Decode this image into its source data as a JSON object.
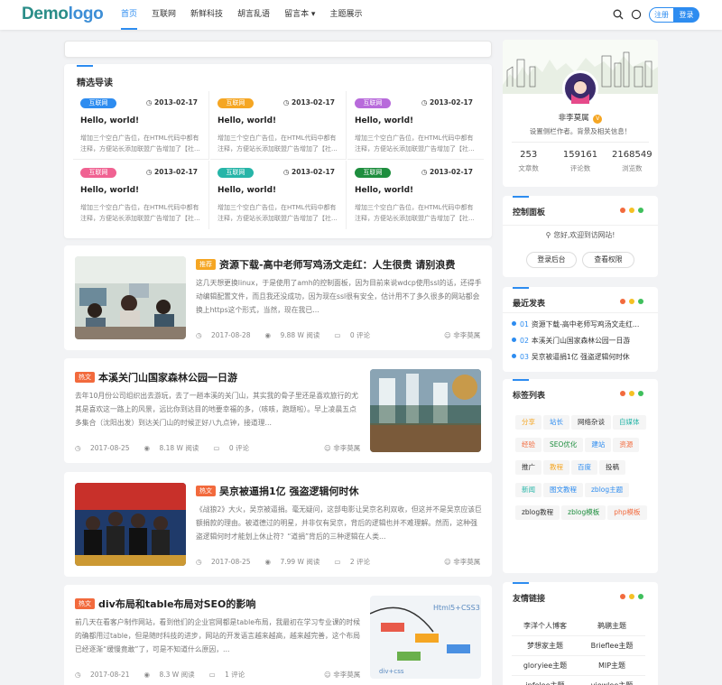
{
  "header": {
    "logo_a": "Demo",
    "logo_b": "logo",
    "nav": [
      "首页",
      "互联网",
      "新鲜科技",
      "胡言乱语",
      "留言本 ▾",
      "主题展示"
    ],
    "register_label": "注册",
    "login_label": "登录",
    "icons": [
      "search-icon",
      "theme-toggle-icon"
    ]
  },
  "featured": {
    "title": "精选导读",
    "items": [
      {
        "tag": "互联网",
        "color": "#2d8cf0",
        "date": "2013-02-17",
        "title": "Hello, world!",
        "desc": "增加三个空白广告位，在HTML代码中都有注释，方便站长添加联盟广告增加了【社..."
      },
      {
        "tag": "互联网",
        "color": "#f5a623",
        "date": "2013-02-17",
        "title": "Hello, world!",
        "desc": "增加三个空白广告位，在HTML代码中都有注释，方便站长添加联盟广告增加了【社..."
      },
      {
        "tag": "互联网",
        "color": "#b86bdb",
        "date": "2013-02-17",
        "title": "Hello, world!",
        "desc": "增加三个空白广告位，在HTML代码中都有注释，方便站长添加联盟广告增加了【社..."
      },
      {
        "tag": "互联网",
        "color": "#f06292",
        "date": "2013-02-17",
        "title": "Hello, world!",
        "desc": "增加三个空白广告位，在HTML代码中都有注释，方便站长添加联盟广告增加了【社..."
      },
      {
        "tag": "互联网",
        "color": "#26b5a8",
        "date": "2013-02-17",
        "title": "Hello, world!",
        "desc": "增加三个空白广告位，在HTML代码中都有注释，方便站长添加联盟广告增加了【社..."
      },
      {
        "tag": "互联网",
        "color": "#1e8e3e",
        "date": "2013-02-17",
        "title": "Hello, world!",
        "desc": "增加三个空白广告位，在HTML代码中都有注释，方便站长添加联盟广告增加了【社..."
      }
    ]
  },
  "posts": [
    {
      "tag": "推荐",
      "tag_color": "#f5a623",
      "title": "资源下载-高中老师写鸡汤文走红：人生很贵 请别浪费",
      "desc": "这几天想更换linux，于是使用了amh的控制面板，因为目前来说wdcp使用ssl的话，还得手动编辑配置文件，而且我还没成功，因为现在ssl很有安全，估计用不了多久很多的网站都会换上https这个形式，当然，现在我已...",
      "date": "2017-08-28",
      "views": "9.88 W 阅读",
      "comments": "0 评论",
      "author": "非李莫属"
    },
    {
      "tag": "热文",
      "tag_color": "#f26a3d",
      "title": "本溪关门山国家森林公园一日游",
      "desc": "去年10月份公司组织出去游玩，去了一趟本溪的关门山，其实我的骨子里还是喜欢旅行的尤其是喜欢这一路上的风景，远比你到达目的地要幸福的多，（咳咳，跑题啦）。早上凌晨五点多集合（沈阳出发）到达关门山的时候正好八九点钟，接道理...",
      "date": "2017-08-25",
      "views": "8.18 W 阅读",
      "comments": "0 评论",
      "author": "非李莫属"
    },
    {
      "tag": "热文",
      "tag_color": "#f26a3d",
      "title": "吴京被逼捐1亿 强盗逻辑何时休",
      "desc": "《战狼2》大火，吴京被逼捐。毫无疑问，这部电影让吴京名利双收，但这并不是吴京应该巨额捐款的理由。被道德过的明星，并非仅有吴京，背后的逻辑也并不难理解。然而，这种强盗逻辑何时才能划上休止符？“道捐”背后的三种逻辑在人类...",
      "date": "2017-08-25",
      "views": "7.99 W 阅读",
      "comments": "2 评论",
      "author": "非李莫属"
    },
    {
      "tag": "热文",
      "tag_color": "#f26a3d",
      "title": "div布局和table布局对SEO的影响",
      "desc": "前几天在看客户制作网站，看到他们的企业官网都是table布局，我最初在学习专业课的时候的确都用过table，但是随时科技的进步，网站的开发语言越来越高，越来越完善，这个布局已经逐渐“缓慢竟敢”了，可是不知道什么原因，...",
      "date": "2017-08-21",
      "views": "8.3 W 阅读",
      "comments": "1 评论",
      "author": "非李莫属"
    }
  ],
  "profile": {
    "name": "非李莫属",
    "badge": "V",
    "bio": "设置侧栏作者。背景及相关信息！",
    "stats": [
      {
        "value": "253",
        "label": "文章数"
      },
      {
        "value": "159161",
        "label": "评论数"
      },
      {
        "value": "2168549",
        "label": "浏览数"
      }
    ]
  },
  "control": {
    "title": "控制面板",
    "welcome": "您好,欢迎到访网站!",
    "btn_admin": "登录后台",
    "btn_perm": "查看权限"
  },
  "recent": {
    "title": "最近发表",
    "items": [
      {
        "num": "01",
        "text": "资源下载-高中老师写鸡汤文走红..."
      },
      {
        "num": "02",
        "text": "本溪关门山国家森林公园一日游"
      },
      {
        "num": "03",
        "text": "吴京被逼捐1亿 强盗逻辑何时休"
      }
    ]
  },
  "tags": {
    "title": "标签列表",
    "items": [
      {
        "text": "分享",
        "color": "#f5a623"
      },
      {
        "text": "站长",
        "color": "#2d8cf0"
      },
      {
        "text": "网络杂谈",
        "color": "#333333"
      },
      {
        "text": "自媒体",
        "color": "#26b5a8"
      },
      {
        "text": "经验",
        "color": "#f26a3d"
      },
      {
        "text": "SEO优化",
        "color": "#1e8e3e"
      },
      {
        "text": "建站",
        "color": "#2d8cf0"
      },
      {
        "text": "资源",
        "color": "#f26a3d"
      },
      {
        "text": "推广",
        "color": "#333333"
      },
      {
        "text": "教程",
        "color": "#f5a623"
      },
      {
        "text": "百度",
        "color": "#2d8cf0"
      },
      {
        "text": "投稿",
        "color": "#333333"
      },
      {
        "text": "新闻",
        "color": "#26b5a8"
      },
      {
        "text": "图文教程",
        "color": "#2d8cf0"
      },
      {
        "text": "zblog主题",
        "color": "#2d8cf0"
      },
      {
        "text": "zblog教程",
        "color": "#333333"
      },
      {
        "text": "zblog模板",
        "color": "#1e8e3e"
      },
      {
        "text": "php模板",
        "color": "#f26a3d"
      }
    ]
  },
  "friends": {
    "title": "友情链接",
    "items": [
      "李洋个人博客",
      "鹈鹕主题",
      "梦想家主题",
      "Brieflee主题",
      "gloryiee主题",
      "MIP主题",
      "infolee主题",
      "viewlee主题"
    ]
  },
  "dot_colors": [
    "#f26a3d",
    "#f5c023",
    "#3fbf5c"
  ]
}
